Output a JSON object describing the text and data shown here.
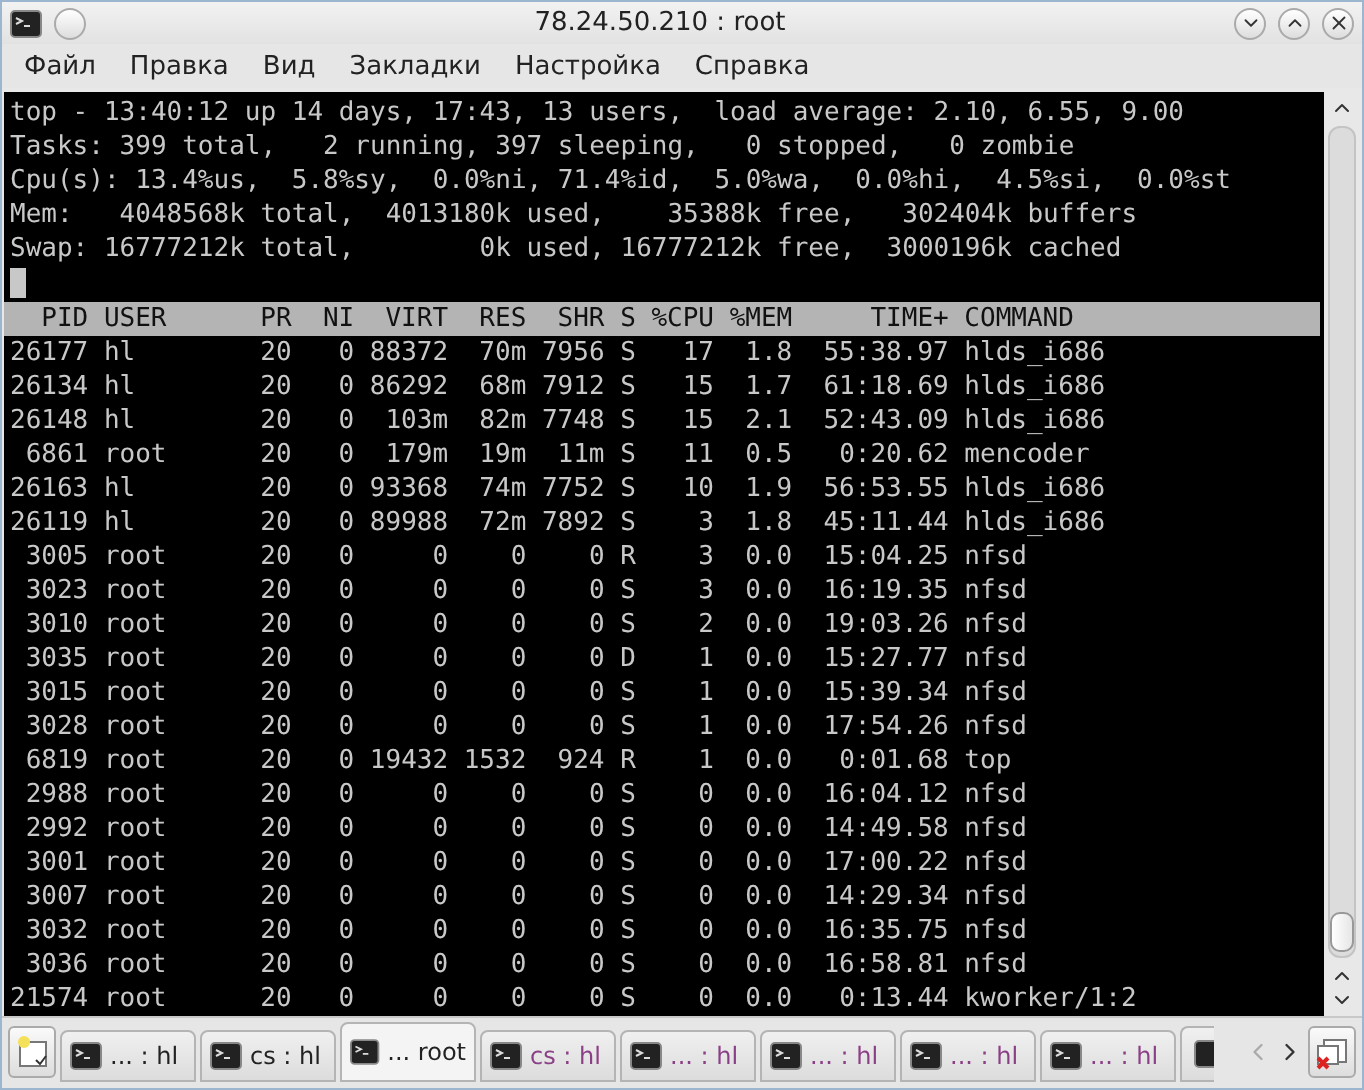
{
  "window": {
    "title": "78.24.50.210 : root"
  },
  "menu": [
    "Файл",
    "Правка",
    "Вид",
    "Закладки",
    "Настройка",
    "Справка"
  ],
  "summary": [
    "top - 13:40:12 up 14 days, 17:43, 13 users,  load average: 2.10, 6.55, 9.00",
    "Tasks: 399 total,   2 running, 397 sleeping,   0 stopped,   0 zombie",
    "Cpu(s): 13.4%us,  5.8%sy,  0.0%ni, 71.4%id,  5.0%wa,  0.0%hi,  4.5%si,  0.0%st",
    "Mem:   4048568k total,  4013180k used,    35388k free,   302404k buffers",
    "Swap: 16777212k total,        0k used, 16777212k free,  3000196k cached"
  ],
  "table": {
    "columns": [
      "PID",
      "USER",
      "PR",
      "NI",
      "VIRT",
      "RES",
      "SHR",
      "S",
      "%CPU",
      "%MEM",
      "TIME+",
      "COMMAND"
    ],
    "rows": [
      [
        "26177",
        "hl",
        "20",
        "0",
        "88372",
        "70m",
        "7956",
        "S",
        "17",
        "1.8",
        "55:38.97",
        "hlds_i686"
      ],
      [
        "26134",
        "hl",
        "20",
        "0",
        "86292",
        "68m",
        "7912",
        "S",
        "15",
        "1.7",
        "61:18.69",
        "hlds_i686"
      ],
      [
        "26148",
        "hl",
        "20",
        "0",
        "103m",
        "82m",
        "7748",
        "S",
        "15",
        "2.1",
        "52:43.09",
        "hlds_i686"
      ],
      [
        "6861",
        "root",
        "20",
        "0",
        "179m",
        "19m",
        "11m",
        "S",
        "11",
        "0.5",
        "0:20.62",
        "mencoder"
      ],
      [
        "26163",
        "hl",
        "20",
        "0",
        "93368",
        "74m",
        "7752",
        "S",
        "10",
        "1.9",
        "56:53.55",
        "hlds_i686"
      ],
      [
        "26119",
        "hl",
        "20",
        "0",
        "89988",
        "72m",
        "7892",
        "S",
        "3",
        "1.8",
        "45:11.44",
        "hlds_i686"
      ],
      [
        "3005",
        "root",
        "20",
        "0",
        "0",
        "0",
        "0",
        "R",
        "3",
        "0.0",
        "15:04.25",
        "nfsd"
      ],
      [
        "3023",
        "root",
        "20",
        "0",
        "0",
        "0",
        "0",
        "S",
        "3",
        "0.0",
        "16:19.35",
        "nfsd"
      ],
      [
        "3010",
        "root",
        "20",
        "0",
        "0",
        "0",
        "0",
        "S",
        "2",
        "0.0",
        "19:03.26",
        "nfsd"
      ],
      [
        "3035",
        "root",
        "20",
        "0",
        "0",
        "0",
        "0",
        "D",
        "1",
        "0.0",
        "15:27.77",
        "nfsd"
      ],
      [
        "3015",
        "root",
        "20",
        "0",
        "0",
        "0",
        "0",
        "S",
        "1",
        "0.0",
        "15:39.34",
        "nfsd"
      ],
      [
        "3028",
        "root",
        "20",
        "0",
        "0",
        "0",
        "0",
        "S",
        "1",
        "0.0",
        "17:54.26",
        "nfsd"
      ],
      [
        "6819",
        "root",
        "20",
        "0",
        "19432",
        "1532",
        "924",
        "R",
        "1",
        "0.0",
        "0:01.68",
        "top"
      ],
      [
        "2988",
        "root",
        "20",
        "0",
        "0",
        "0",
        "0",
        "S",
        "0",
        "0.0",
        "16:04.12",
        "nfsd"
      ],
      [
        "2992",
        "root",
        "20",
        "0",
        "0",
        "0",
        "0",
        "S",
        "0",
        "0.0",
        "14:49.58",
        "nfsd"
      ],
      [
        "3001",
        "root",
        "20",
        "0",
        "0",
        "0",
        "0",
        "S",
        "0",
        "0.0",
        "17:00.22",
        "nfsd"
      ],
      [
        "3007",
        "root",
        "20",
        "0",
        "0",
        "0",
        "0",
        "S",
        "0",
        "0.0",
        "14:29.34",
        "nfsd"
      ],
      [
        "3032",
        "root",
        "20",
        "0",
        "0",
        "0",
        "0",
        "S",
        "0",
        "0.0",
        "16:35.75",
        "nfsd"
      ],
      [
        "3036",
        "root",
        "20",
        "0",
        "0",
        "0",
        "0",
        "S",
        "0",
        "0.0",
        "16:58.81",
        "nfsd"
      ],
      [
        "21574",
        "root",
        "20",
        "0",
        "0",
        "0",
        "0",
        "S",
        "0",
        "0.0",
        "0:13.44",
        "kworker/1:2"
      ]
    ]
  },
  "tabs": [
    {
      "label": "... : hl",
      "selected": false,
      "activity": false
    },
    {
      "label": "cs : hl",
      "selected": false,
      "activity": false
    },
    {
      "label": "... root",
      "selected": true,
      "activity": false
    },
    {
      "label": "cs : hl",
      "selected": false,
      "activity": true
    },
    {
      "label": "... : hl",
      "selected": false,
      "activity": true
    },
    {
      "label": "... : hl",
      "selected": false,
      "activity": true
    },
    {
      "label": "... : hl",
      "selected": false,
      "activity": true
    },
    {
      "label": "... : hl",
      "selected": false,
      "activity": true
    }
  ],
  "more_tabs_hidden": true
}
